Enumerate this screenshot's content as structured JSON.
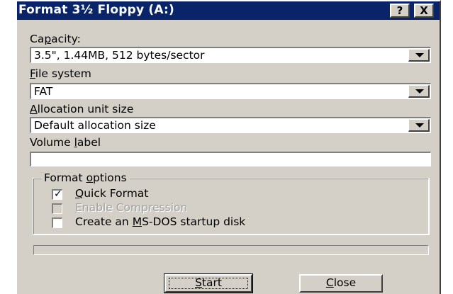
{
  "window": {
    "title": "Format 3½ Floppy (A:)",
    "help_label": "?",
    "close_label": "X"
  },
  "capacity": {
    "label_pre": "Ca",
    "label_key": "p",
    "label_post": "acity:",
    "value": "3.5\",  1.44MB, 512 bytes/sector"
  },
  "file_system": {
    "label_key": "F",
    "label_post": "ile system",
    "value": "FAT"
  },
  "allocation": {
    "label_key": "A",
    "label_post": "llocation unit size",
    "value": "Default allocation size"
  },
  "volume_label": {
    "label_pre": "Volume ",
    "label_key": "l",
    "label_post": "abel",
    "value": ""
  },
  "format_options": {
    "label_pre": "Format ",
    "label_key": "o",
    "label_post": "ptions",
    "quick_format": {
      "checked": true,
      "label_key": "Q",
      "label_post": "uick Format"
    },
    "enable_compression": {
      "checked": false,
      "disabled": true,
      "label_key": "E",
      "label_post": "nable Compression"
    },
    "startup_disk": {
      "checked": false,
      "label_pre": "Create an ",
      "label_key": "M",
      "label_post": "S-DOS startup disk"
    }
  },
  "progress": {
    "value": 0
  },
  "buttons": {
    "start_key": "S",
    "start_post": "tart",
    "close_key": "C",
    "close_post": "lose"
  },
  "colors": {
    "face": "#d4d0c8",
    "titlebar": "#0a246a",
    "shadow": "#808080",
    "dark_shadow": "#404040",
    "disabled_text": "#a0a0a0"
  }
}
